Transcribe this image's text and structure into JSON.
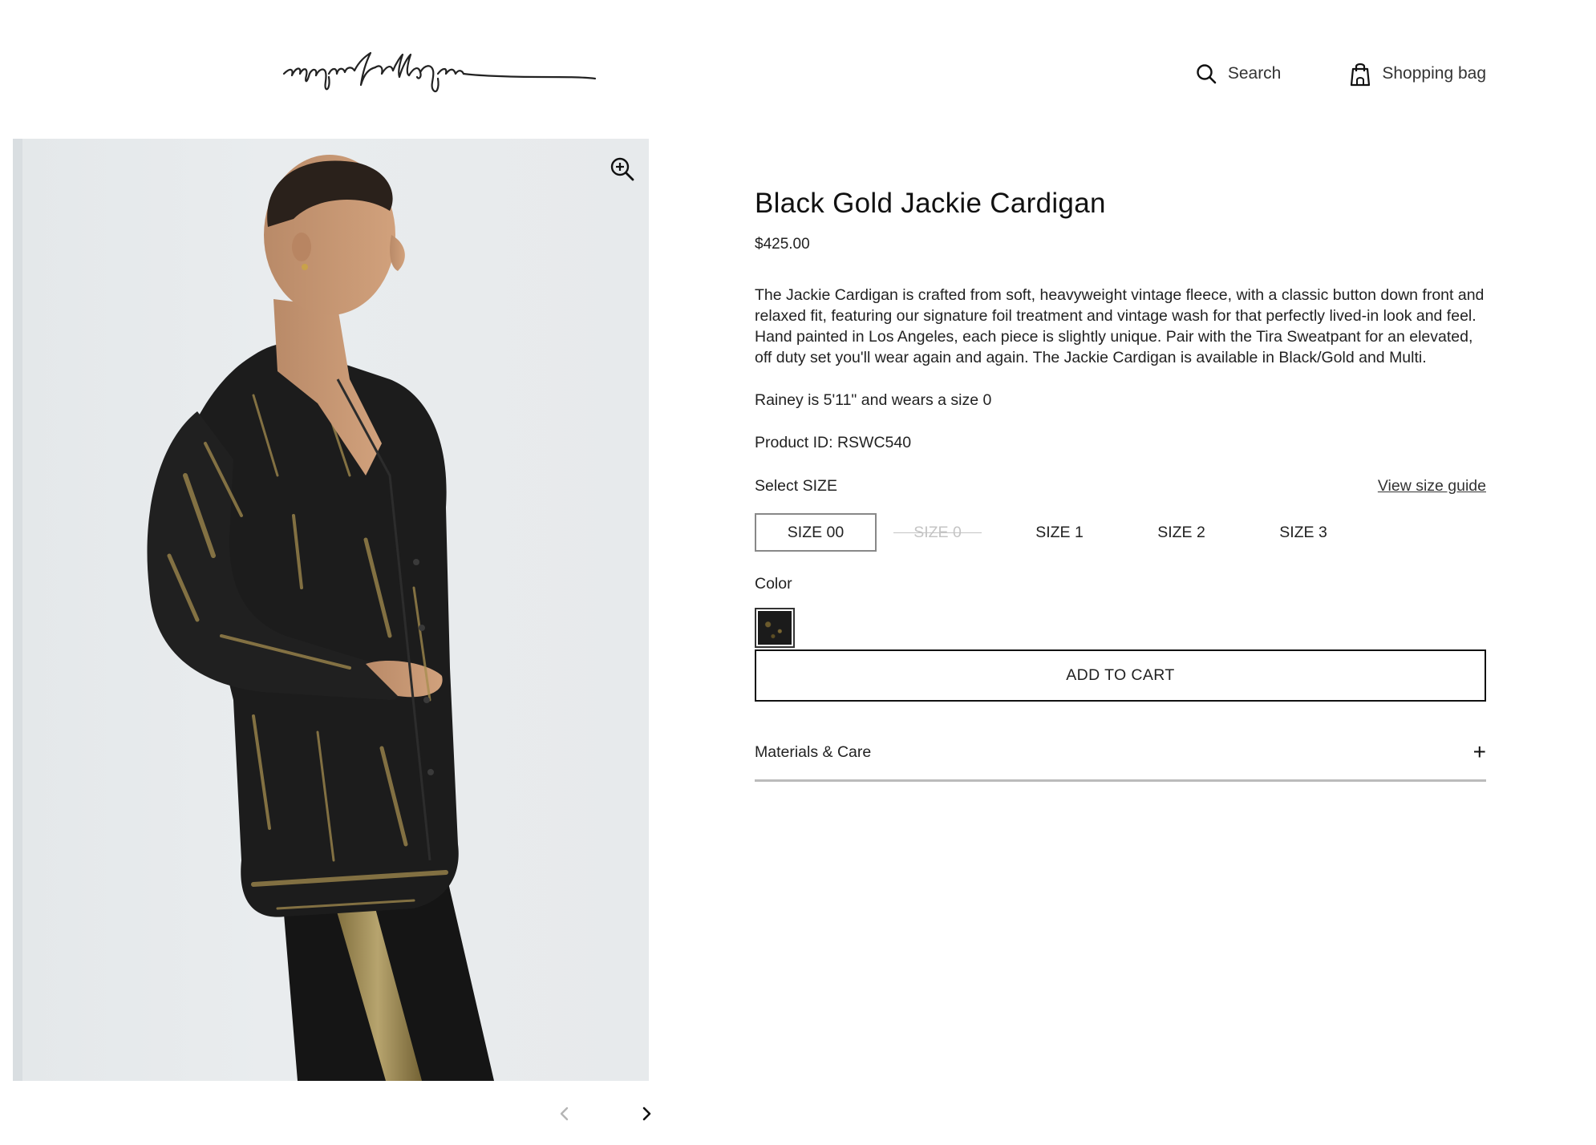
{
  "header": {
    "logo_alt": "raquel allegra",
    "search_label": "Search",
    "bag_label": "Shopping bag"
  },
  "gallery": {
    "zoom_icon": "zoom-in-icon",
    "prev_icon": "chevron-left-icon",
    "next_icon": "chevron-right-icon"
  },
  "product": {
    "title": "Black Gold Jackie Cardigan",
    "price": "$425.00",
    "description": "The Jackie Cardigan is crafted from soft, heavyweight vintage fleece, with a classic button down front and relaxed fit, featuring our signature foil treatment and vintage wash for that perfectly lived-in look and feel. Hand painted in Los Angeles, each piece is slightly unique. Pair with the Tira Sweatpant for an elevated, off duty set you'll wear again and again. The Jackie Cardigan is available in Black/Gold and Multi.",
    "model_note": "Rainey is 5'11\" and wears a size 0",
    "product_id": "Product ID: RSWC540",
    "select_size_label": "Select SIZE",
    "size_guide_label": "View size guide",
    "sizes": [
      {
        "label": "SIZE 00",
        "state": "selected"
      },
      {
        "label": "SIZE 0",
        "state": "unavailable"
      },
      {
        "label": "SIZE 1",
        "state": "available"
      },
      {
        "label": "SIZE 2",
        "state": "available"
      },
      {
        "label": "SIZE 3",
        "state": "available"
      }
    ],
    "color_label": "Color",
    "add_to_cart_label": "ADD TO CART",
    "materials_label": "Materials & Care",
    "materials_toggle": "+"
  },
  "colors": {
    "text": "#222222",
    "border_dark": "#111111",
    "gallery_bg": "#e8ebed"
  }
}
